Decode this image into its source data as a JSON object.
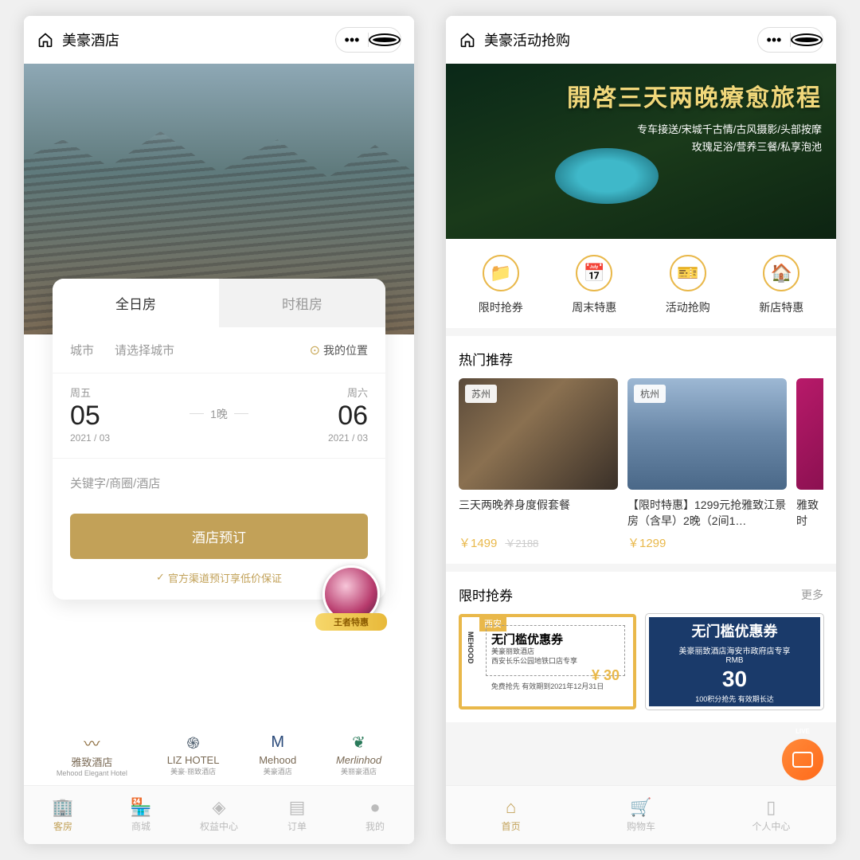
{
  "left": {
    "title": "美豪酒店",
    "tabs": {
      "full": "全日房",
      "hourly": "时租房"
    },
    "city": {
      "label": "城市",
      "placeholder": "请选择城市",
      "mylocation": "我的位置"
    },
    "checkin": {
      "weekday": "周五",
      "day": "05",
      "ym": "2021 / 03"
    },
    "checkout": {
      "weekday": "周六",
      "day": "06",
      "ym": "2021 / 03"
    },
    "nights": "1晚",
    "keyword": "关键字/商圈/酒店",
    "book": "酒店预订",
    "guarantee": "官方渠道预订享低价保证",
    "promo": "王者特惠",
    "brands": [
      {
        "l1": "雅致酒店",
        "l2": "Mehood Elegant Hotel"
      },
      {
        "l1": "LIZ HOTEL",
        "l2": "美豪·丽致酒店"
      },
      {
        "l1": "Mehood",
        "l2": "美豪酒店"
      },
      {
        "l1": "Merlinhod",
        "l2": "美丽豪酒店"
      }
    ],
    "tabbar": [
      "客房",
      "商城",
      "权益中心",
      "订单",
      "我的"
    ]
  },
  "right": {
    "title": "美豪活动抢购",
    "hero": {
      "title": "開啓三天两晚療愈旅程",
      "sub1": "专车接送/宋城千古情/古风摄影/头部按摩",
      "sub2": "玫瑰足浴/营养三餐/私享泡池"
    },
    "menu": [
      "限时抢券",
      "周末特惠",
      "活动抢购",
      "新店特惠"
    ],
    "sect1": "热门推荐",
    "more": "更多",
    "cards": [
      {
        "city": "苏州",
        "title": "三天两晚养身度假套餐",
        "price": "￥1499",
        "old": "￥2188"
      },
      {
        "city": "杭州",
        "title": "【限时特惠】1299元抢雅致江景房（含早）2晚（2间1…",
        "price": "￥1299",
        "old": ""
      },
      {
        "city": "",
        "title": "雅致时特…",
        "price": "",
        "old": ""
      }
    ],
    "sect2": "限时抢券",
    "coupon1": {
      "city": "西安",
      "side": "MEHOOD",
      "big": "无门槛优惠券",
      "l1": "美豪丽致酒店",
      "l2": "西安长乐公园地铁口店专享",
      "amt": "¥ 30",
      "foot": "免费抢先  有效期到2021年12月31日"
    },
    "coupon2": {
      "big": "无门槛优惠券",
      "l1": "美豪丽致酒店海安市政府店专享",
      "rmb": "RMB",
      "amt": "30",
      "foot": "100积分抢先  有效期长达"
    },
    "tabbar": [
      "首页",
      "购物车",
      "个人中心"
    ]
  }
}
